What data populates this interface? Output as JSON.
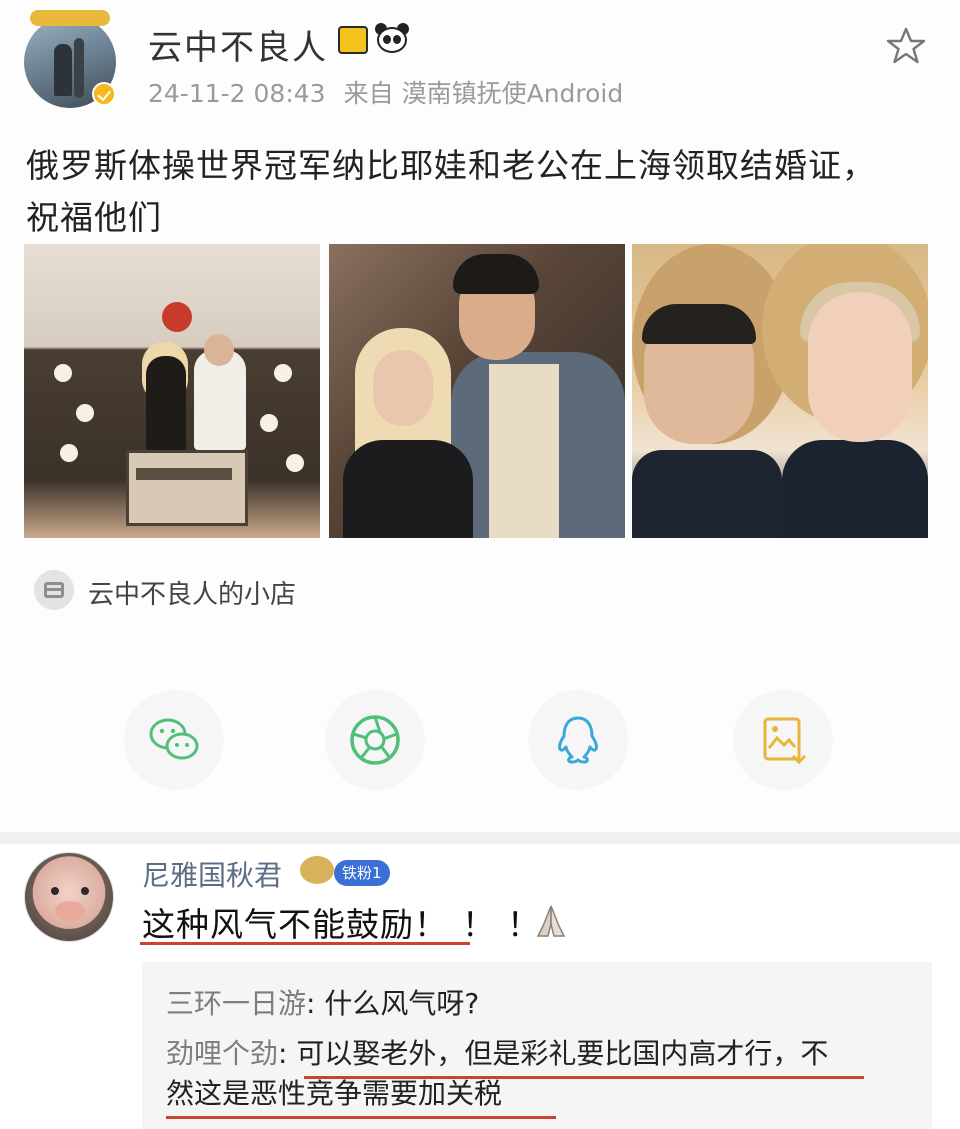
{
  "post": {
    "author": "云中不良人",
    "avatar_banner": "",
    "vip_badge": "",
    "date": "24-11-2 08:43",
    "source_prefix": "来自",
    "source": "漠南镇抚使Android",
    "text_line1": "俄罗斯体操世界冠军纳比耶娃和老公在上海领取结婚证，",
    "text_line2": "祝福他们",
    "shop_label": "云中不良人的小店"
  },
  "share_icons": [
    "wechat-icon",
    "moments-icon",
    "qq-icon",
    "save-image-icon"
  ],
  "colors": {
    "wechat": "#4fbf7a",
    "moments": "#4fbf7a",
    "qq": "#3aa8d8",
    "save": "#e7b53a",
    "underline": "#c8442e",
    "comment_name": "#5c6d86"
  },
  "comment": {
    "author": "尼雅国秋君",
    "fan_badge": "铁粉1",
    "text_main": "这种风气不能鼓励！",
    "text_tail": "！！",
    "replies": [
      {
        "author": "三环一日游",
        "text": "什么风气呀?"
      },
      {
        "author": "劲哩个劲",
        "text_line1": "可以娶老外，但是彩礼要比国内高才行，不",
        "text_line2": "然这是恶性竞争需要加关税"
      }
    ]
  }
}
